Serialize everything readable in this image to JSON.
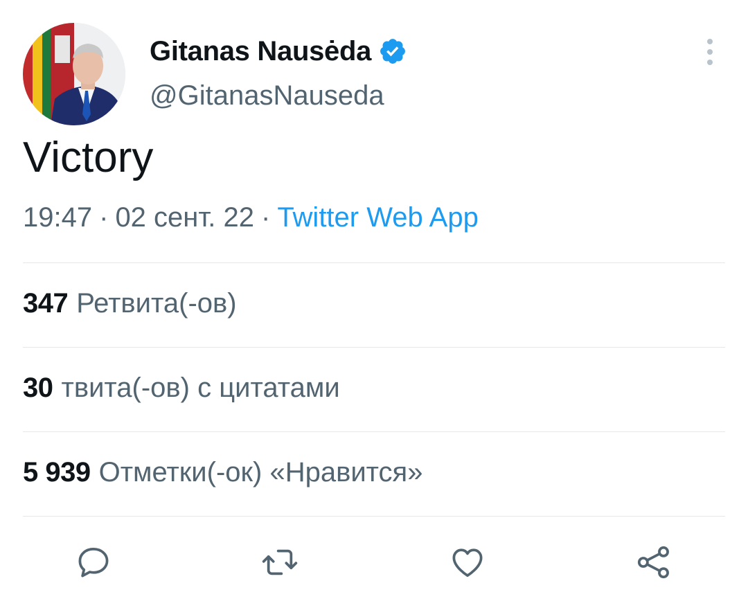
{
  "author": {
    "display_name": "Gitanas Nausėda",
    "handle": "@GitanasNauseda",
    "verified": true
  },
  "tweet": {
    "text": "Victory",
    "time": "19:47",
    "date": "02 сент. 22",
    "source": "Twitter Web App",
    "separator": "·"
  },
  "stats": [
    {
      "count": "347",
      "label": "Ретвита(-ов)"
    },
    {
      "count": "30",
      "label": "твита(-ов) с цитатами"
    },
    {
      "count": "5 939",
      "label": "Отметки(-ок) «Нравится»"
    }
  ],
  "icons": {
    "more": "more-vertical-icon",
    "verified": "verified-badge-icon",
    "reply": "reply-icon",
    "retweet": "retweet-icon",
    "like": "heart-icon",
    "share": "share-icon"
  },
  "colors": {
    "text_primary": "#0f1419",
    "text_secondary": "#536471",
    "accent": "#1d9bf0",
    "divider": "#e4e8eb",
    "icon": "#536471"
  }
}
